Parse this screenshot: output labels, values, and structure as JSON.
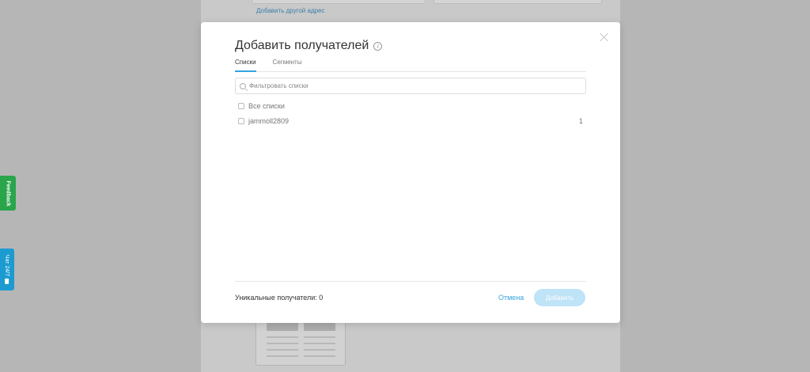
{
  "background": {
    "link": "Добавить другой адрес"
  },
  "side_tabs": {
    "feedback": "Feedback",
    "chat": "Чат 24/7"
  },
  "modal": {
    "title": "Добавить получателей",
    "info_icon": "i",
    "tabs": [
      {
        "label": "Списки",
        "active": true
      },
      {
        "label": "Сегменты",
        "active": false
      }
    ],
    "filter_placeholder": "Фильтровать списки",
    "lists": [
      {
        "label": "Все списки",
        "count": "",
        "checked": false
      },
      {
        "label": "jammoll2809",
        "count": "1",
        "checked": false
      }
    ],
    "unique_recipients": "Уникальные получатели: 0",
    "cancel_label": "Отмена",
    "add_label": "Добавить"
  },
  "colors": {
    "accent": "#36a3e0",
    "feedback_green": "#2aa54c",
    "chat_blue": "#1c9bd1",
    "overlay": "#b6b6b6"
  }
}
